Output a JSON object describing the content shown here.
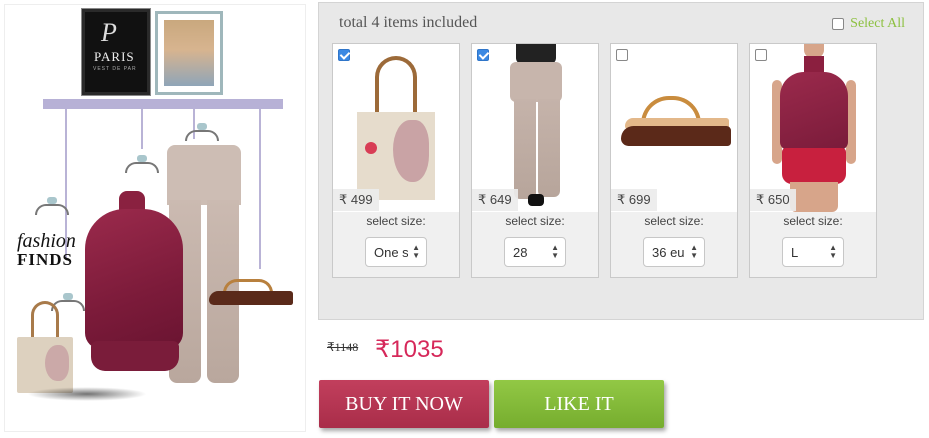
{
  "collage": {
    "frame_letter": "P",
    "frame_word": "PARIS",
    "frame_sub": "VEST DE PAR",
    "brand_line1": "fashion",
    "brand_line2": "FINDS"
  },
  "bundle": {
    "title": "total 4 items included",
    "select_all_label": "Select All",
    "select_all_checked": false
  },
  "items": [
    {
      "name": "tote bag",
      "price": "₹ 499",
      "checked": true,
      "size_label": "select size:",
      "size_value": "One size"
    },
    {
      "name": "printed jeans",
      "price": "₹ 649",
      "checked": true,
      "size_label": "select size:",
      "size_value": "28"
    },
    {
      "name": "sandal",
      "price": "₹ 699",
      "checked": false,
      "size_label": "select size:",
      "size_value": "36 eu"
    },
    {
      "name": "halter top",
      "price": "₹ 650",
      "checked": false,
      "size_label": "select size:",
      "size_value": "L"
    }
  ],
  "pricing": {
    "old_price": "₹1148",
    "new_price": "₹1035"
  },
  "actions": {
    "buy_label": "BUY IT NOW",
    "like_label": "LIKE IT"
  },
  "colors": {
    "buy": "#b8344f",
    "like": "#86bd3b",
    "price": "#d6285a",
    "select_all": "#8dc040",
    "panel": "#e8e8e8"
  }
}
